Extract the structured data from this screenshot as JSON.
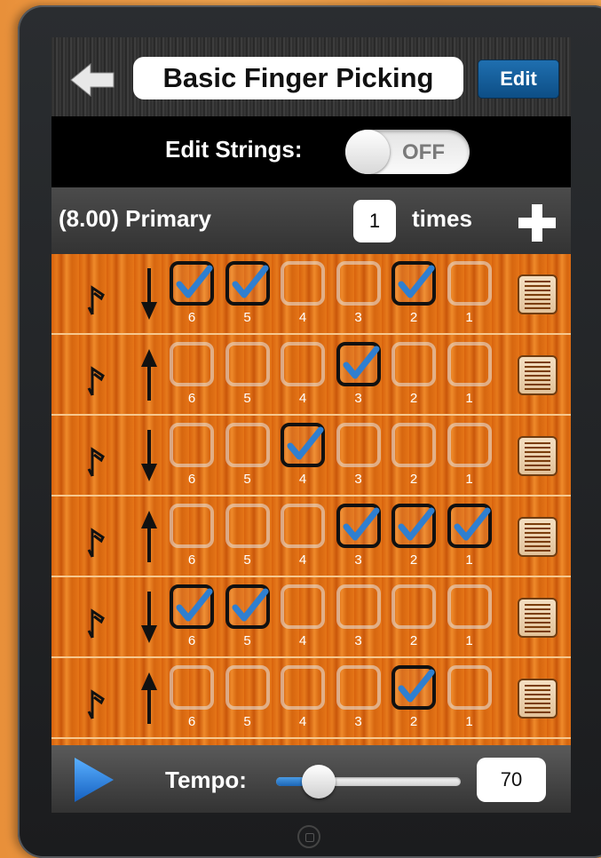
{
  "header": {
    "back_icon": "back-arrow-icon",
    "title": "Basic Finger Picking",
    "edit_label": "Edit"
  },
  "edit_strings": {
    "label": "Edit Strings:",
    "toggle_state": "OFF"
  },
  "pattern": {
    "name": "(8.00) Primary",
    "repeat_count": "1",
    "times_label": "times",
    "add_icon": "plus-icon"
  },
  "rows": [
    {
      "direction": "down",
      "checked": [
        true,
        true,
        false,
        false,
        true,
        false
      ]
    },
    {
      "direction": "up",
      "checked": [
        false,
        false,
        false,
        true,
        false,
        false
      ]
    },
    {
      "direction": "down",
      "checked": [
        false,
        false,
        true,
        false,
        false,
        false
      ]
    },
    {
      "direction": "up",
      "checked": [
        false,
        false,
        false,
        true,
        true,
        true
      ]
    },
    {
      "direction": "down",
      "checked": [
        true,
        true,
        false,
        false,
        false,
        false
      ]
    },
    {
      "direction": "up",
      "checked": [
        false,
        false,
        false,
        false,
        true,
        false
      ]
    }
  ],
  "string_numbers": [
    "6",
    "5",
    "4",
    "3",
    "2",
    "1"
  ],
  "icons": {
    "note": "eighth-note-icon",
    "row_menu": "list-icon",
    "check": "checkmark-icon"
  },
  "footer": {
    "play_icon": "play-icon",
    "tempo_label": "Tempo:",
    "tempo_value": "70",
    "tempo_slider_level": 0.2
  },
  "colors": {
    "check_blue": "#2f7fd0",
    "edit_button": "#125f9e",
    "wood_orange": "#e0701a"
  }
}
